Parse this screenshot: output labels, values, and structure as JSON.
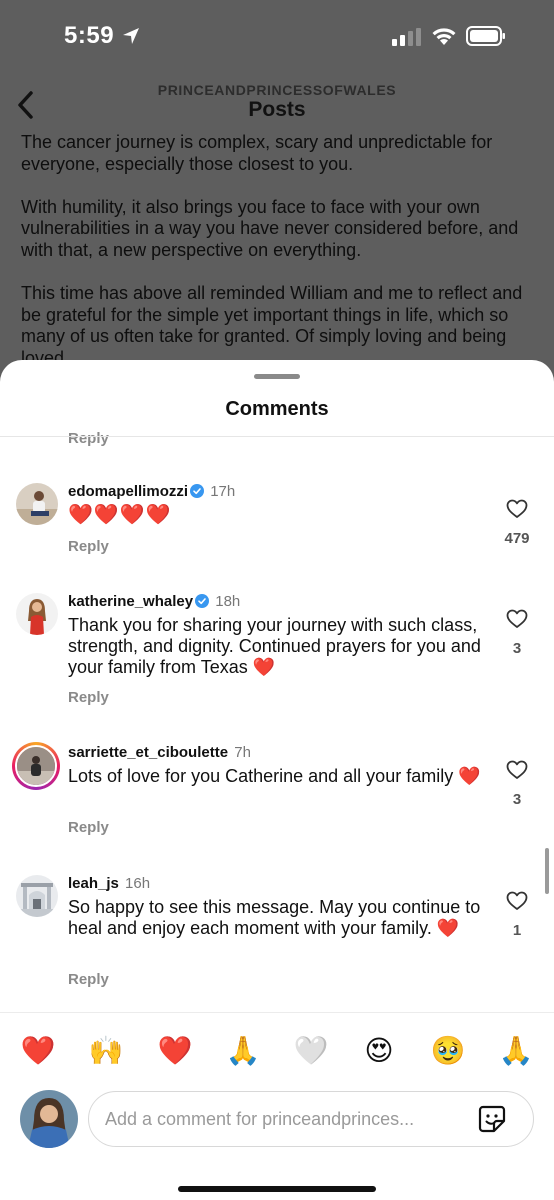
{
  "status_bar": {
    "time": "5:59"
  },
  "header": {
    "account": "PRINCEANDPRINCESSOFWALES",
    "title": "Posts"
  },
  "caption": {
    "paragraphs": [
      "The cancer journey is complex, scary and unpredictable for everyone, especially those closest to you.",
      "With humility, it also brings you face to face with your own vulnerabilities in a way you have never considered before, and with that, a new perspective on everything.",
      "This time has above all reminded William and me to reflect and be grateful for the simple yet important things in life, which so many of us often take for granted. Of simply loving and being loved."
    ]
  },
  "sheet": {
    "title": "Comments",
    "reply_label": "Reply"
  },
  "comments": [
    {
      "username": "edomapellimozzi",
      "verified": true,
      "time": "17h",
      "text": "❤️❤️❤️❤️",
      "likes": "479"
    },
    {
      "username": "katherine_whaley",
      "verified": true,
      "time": "18h",
      "text": "Thank you for sharing your journey with such class, strength, and dignity. Continued prayers for you and your family from Texas ❤️",
      "likes": "3"
    },
    {
      "username": "sarriette_et_ciboulette",
      "verified": false,
      "time": "7h",
      "text": "Lots of love for you Catherine and all your family ❤️",
      "likes": "3"
    },
    {
      "username": "leah_js",
      "verified": false,
      "time": "16h",
      "text": "So happy to see this message. May you continue to heal and enjoy each moment with your family. ❤️",
      "likes": "1"
    }
  ],
  "emoji_bar": [
    "❤️",
    "🙌",
    "❤️",
    "🙏",
    "🤍",
    "😍",
    "🥹",
    "🙏"
  ],
  "composer": {
    "placeholder": "Add a comment for princeandprinces..."
  },
  "colors": {
    "verified": "#3897f0",
    "heart": "#e0245e",
    "muted": "#8a8a8a"
  }
}
